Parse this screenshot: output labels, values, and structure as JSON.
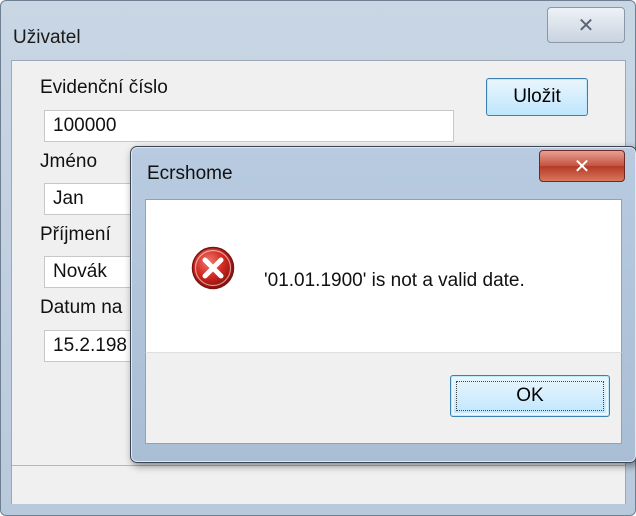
{
  "main_window": {
    "title": "Uživatel",
    "close_glyph": "✕",
    "fields": [
      {
        "label": "Evidenční číslo",
        "value": "100000"
      },
      {
        "label": "Jméno",
        "value": "Jan"
      },
      {
        "label": "Příjmení",
        "value": "Novák"
      },
      {
        "label": "Datum na",
        "value": "15.2.198"
      }
    ],
    "save_label": "Uložit"
  },
  "dialog": {
    "title": "Ecrshome",
    "close_glyph": "✕",
    "icon": "error-icon",
    "message": "'01.01.1900' is not a valid date.",
    "ok_label": "OK"
  },
  "colors": {
    "error_red": "#c8201c",
    "accent_blue": "#3c7fb1"
  }
}
